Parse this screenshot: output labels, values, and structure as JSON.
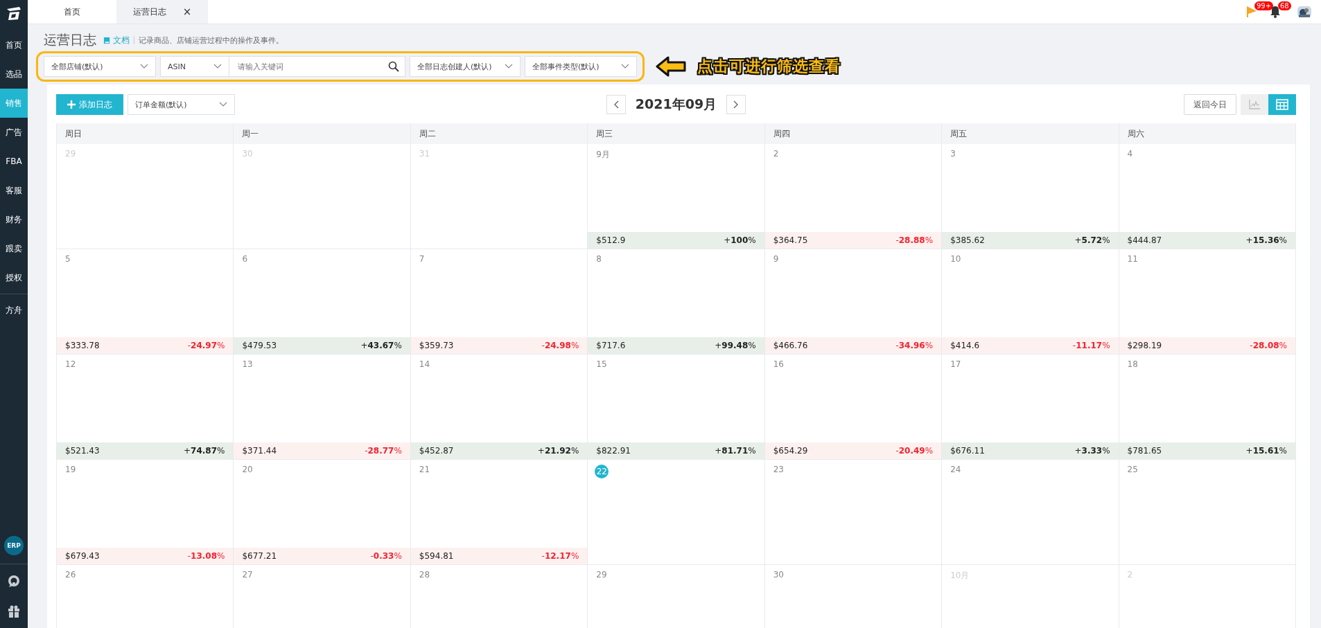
{
  "sidebar": {
    "groups": [
      [
        {
          "label": "首页",
          "selected": false
        },
        {
          "label": "选品",
          "selected": false
        },
        {
          "label": "销售",
          "selected": true
        },
        {
          "label": "广告",
          "selected": false
        },
        {
          "label": "FBA",
          "selected": false
        },
        {
          "label": "客服",
          "selected": false
        },
        {
          "label": "财务",
          "selected": false
        },
        {
          "label": "跟卖",
          "selected": false
        },
        {
          "label": "授权",
          "selected": false
        }
      ],
      [
        {
          "label": "方舟",
          "selected": false
        }
      ]
    ],
    "erp_badge": "ERP"
  },
  "tabs": [
    {
      "label": "首页",
      "selected": false,
      "closable": false
    },
    {
      "label": "运营日志",
      "selected": true,
      "closable": true,
      "close": "×"
    }
  ],
  "topbar": {
    "flag_badge": "99+",
    "bell_badge": "68"
  },
  "page": {
    "title": "运营日志",
    "doc_link": "文档",
    "description": "记录商品、店铺运营过程中的操作及事件。"
  },
  "filters": {
    "store": "全部店铺(默认)",
    "field": "ASIN",
    "search_placeholder": "请输入关键词",
    "creator": "全部日志创建人(默认)",
    "event_type": "全部事件类型(默认)"
  },
  "annotation": {
    "text": "点击可进行筛选查看"
  },
  "toolbar": {
    "add_button": "添加日志",
    "metric": "订单金额(默认)",
    "month": "2021年09月",
    "today_button": "返回今日",
    "views": [
      {
        "kind": "chart",
        "selected": false
      },
      {
        "kind": "table",
        "selected": true
      }
    ]
  },
  "calendar": {
    "weekdays": [
      "周日",
      "周一",
      "周二",
      "周三",
      "周四",
      "周五",
      "周六"
    ],
    "weeks": [
      [
        {
          "day": "29",
          "muted": true,
          "today": false
        },
        {
          "day": "30",
          "muted": true,
          "today": false
        },
        {
          "day": "31",
          "muted": true,
          "today": false
        },
        {
          "day": "9月",
          "muted": false,
          "today": false,
          "amount": "$512.9",
          "change": "+**100**%",
          "rising": true
        },
        {
          "day": "2",
          "muted": false,
          "today": false,
          "amount": "$364.75",
          "change": "-**28.88**%",
          "rising": false
        },
        {
          "day": "3",
          "muted": false,
          "today": false,
          "amount": "$385.62",
          "change": "+**5.72**%",
          "rising": true
        },
        {
          "day": "4",
          "muted": false,
          "today": false,
          "amount": "$444.87",
          "change": "+**15.36**%",
          "rising": true
        }
      ],
      [
        {
          "day": "5",
          "muted": false,
          "today": false,
          "amount": "$333.78",
          "change": "-**24.97**%",
          "rising": false
        },
        {
          "day": "6",
          "muted": false,
          "today": false,
          "amount": "$479.53",
          "change": "+**43.67**%",
          "rising": true
        },
        {
          "day": "7",
          "muted": false,
          "today": false,
          "amount": "$359.73",
          "change": "-**24.98**%",
          "rising": false
        },
        {
          "day": "8",
          "muted": false,
          "today": false,
          "amount": "$717.6",
          "change": "+**99.48**%",
          "rising": true
        },
        {
          "day": "9",
          "muted": false,
          "today": false,
          "amount": "$466.76",
          "change": "-**34.96**%",
          "rising": false
        },
        {
          "day": "10",
          "muted": false,
          "today": false,
          "amount": "$414.6",
          "change": "-**11.17**%",
          "rising": false
        },
        {
          "day": "11",
          "muted": false,
          "today": false,
          "amount": "$298.19",
          "change": "-**28.08**%",
          "rising": false
        }
      ],
      [
        {
          "day": "12",
          "muted": false,
          "today": false,
          "amount": "$521.43",
          "change": "+**74.87**%",
          "rising": true
        },
        {
          "day": "13",
          "muted": false,
          "today": false,
          "amount": "$371.44",
          "change": "-**28.77**%",
          "rising": false
        },
        {
          "day": "14",
          "muted": false,
          "today": false,
          "amount": "$452.87",
          "change": "+**21.92**%",
          "rising": true
        },
        {
          "day": "15",
          "muted": false,
          "today": false,
          "amount": "$822.91",
          "change": "+**81.71**%",
          "rising": true
        },
        {
          "day": "16",
          "muted": false,
          "today": false,
          "amount": "$654.29",
          "change": "-**20.49**%",
          "rising": false
        },
        {
          "day": "17",
          "muted": false,
          "today": false,
          "amount": "$676.11",
          "change": "+**3.33**%",
          "rising": true
        },
        {
          "day": "18",
          "muted": false,
          "today": false,
          "amount": "$781.65",
          "change": "+**15.61**%",
          "rising": true
        }
      ],
      [
        {
          "day": "19",
          "muted": false,
          "today": false,
          "amount": "$679.43",
          "change": "-**13.08**%",
          "rising": false
        },
        {
          "day": "20",
          "muted": false,
          "today": false,
          "amount": "$677.21",
          "change": "-**0.33**%",
          "rising": false
        },
        {
          "day": "21",
          "muted": false,
          "today": false,
          "amount": "$594.81",
          "change": "-**12.17**%",
          "rising": false
        },
        {
          "day": "22",
          "muted": false,
          "today": true
        },
        {
          "day": "23",
          "muted": false,
          "today": false
        },
        {
          "day": "24",
          "muted": false,
          "today": false
        },
        {
          "day": "25",
          "muted": false,
          "today": false
        }
      ],
      [
        {
          "day": "26",
          "muted": false,
          "today": false
        },
        {
          "day": "27",
          "muted": false,
          "today": false
        },
        {
          "day": "28",
          "muted": false,
          "today": false
        },
        {
          "day": "29",
          "muted": false,
          "today": false
        },
        {
          "day": "30",
          "muted": false,
          "today": false
        },
        {
          "day": "10月",
          "muted": true,
          "today": false
        },
        {
          "day": "2",
          "muted": true,
          "today": false
        }
      ]
    ]
  }
}
